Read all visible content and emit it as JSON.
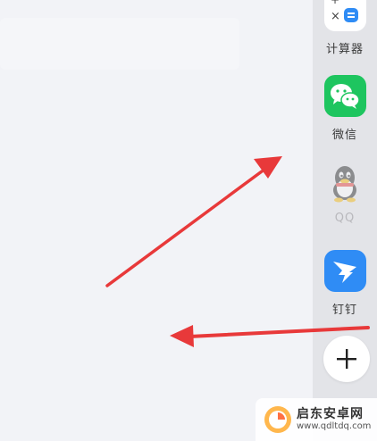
{
  "sidebar": {
    "apps": [
      {
        "label": "计算器",
        "icon": "calculator-icon",
        "color": "#2f8cf5"
      },
      {
        "label": "微信",
        "icon": "wechat-icon",
        "color": "#1ec55f"
      },
      {
        "label": "QQ",
        "icon": "qq-penguin-icon",
        "color": "#b8b8bc"
      },
      {
        "label": "钉钉",
        "icon": "dingtalk-icon",
        "color": "#2f8cf5"
      }
    ],
    "add_icon": "plus-icon"
  },
  "watermark": {
    "title": "启东安卓网",
    "url": "www.qdltdq.com"
  },
  "annotations": {
    "arrow_color": "#e8393a"
  }
}
